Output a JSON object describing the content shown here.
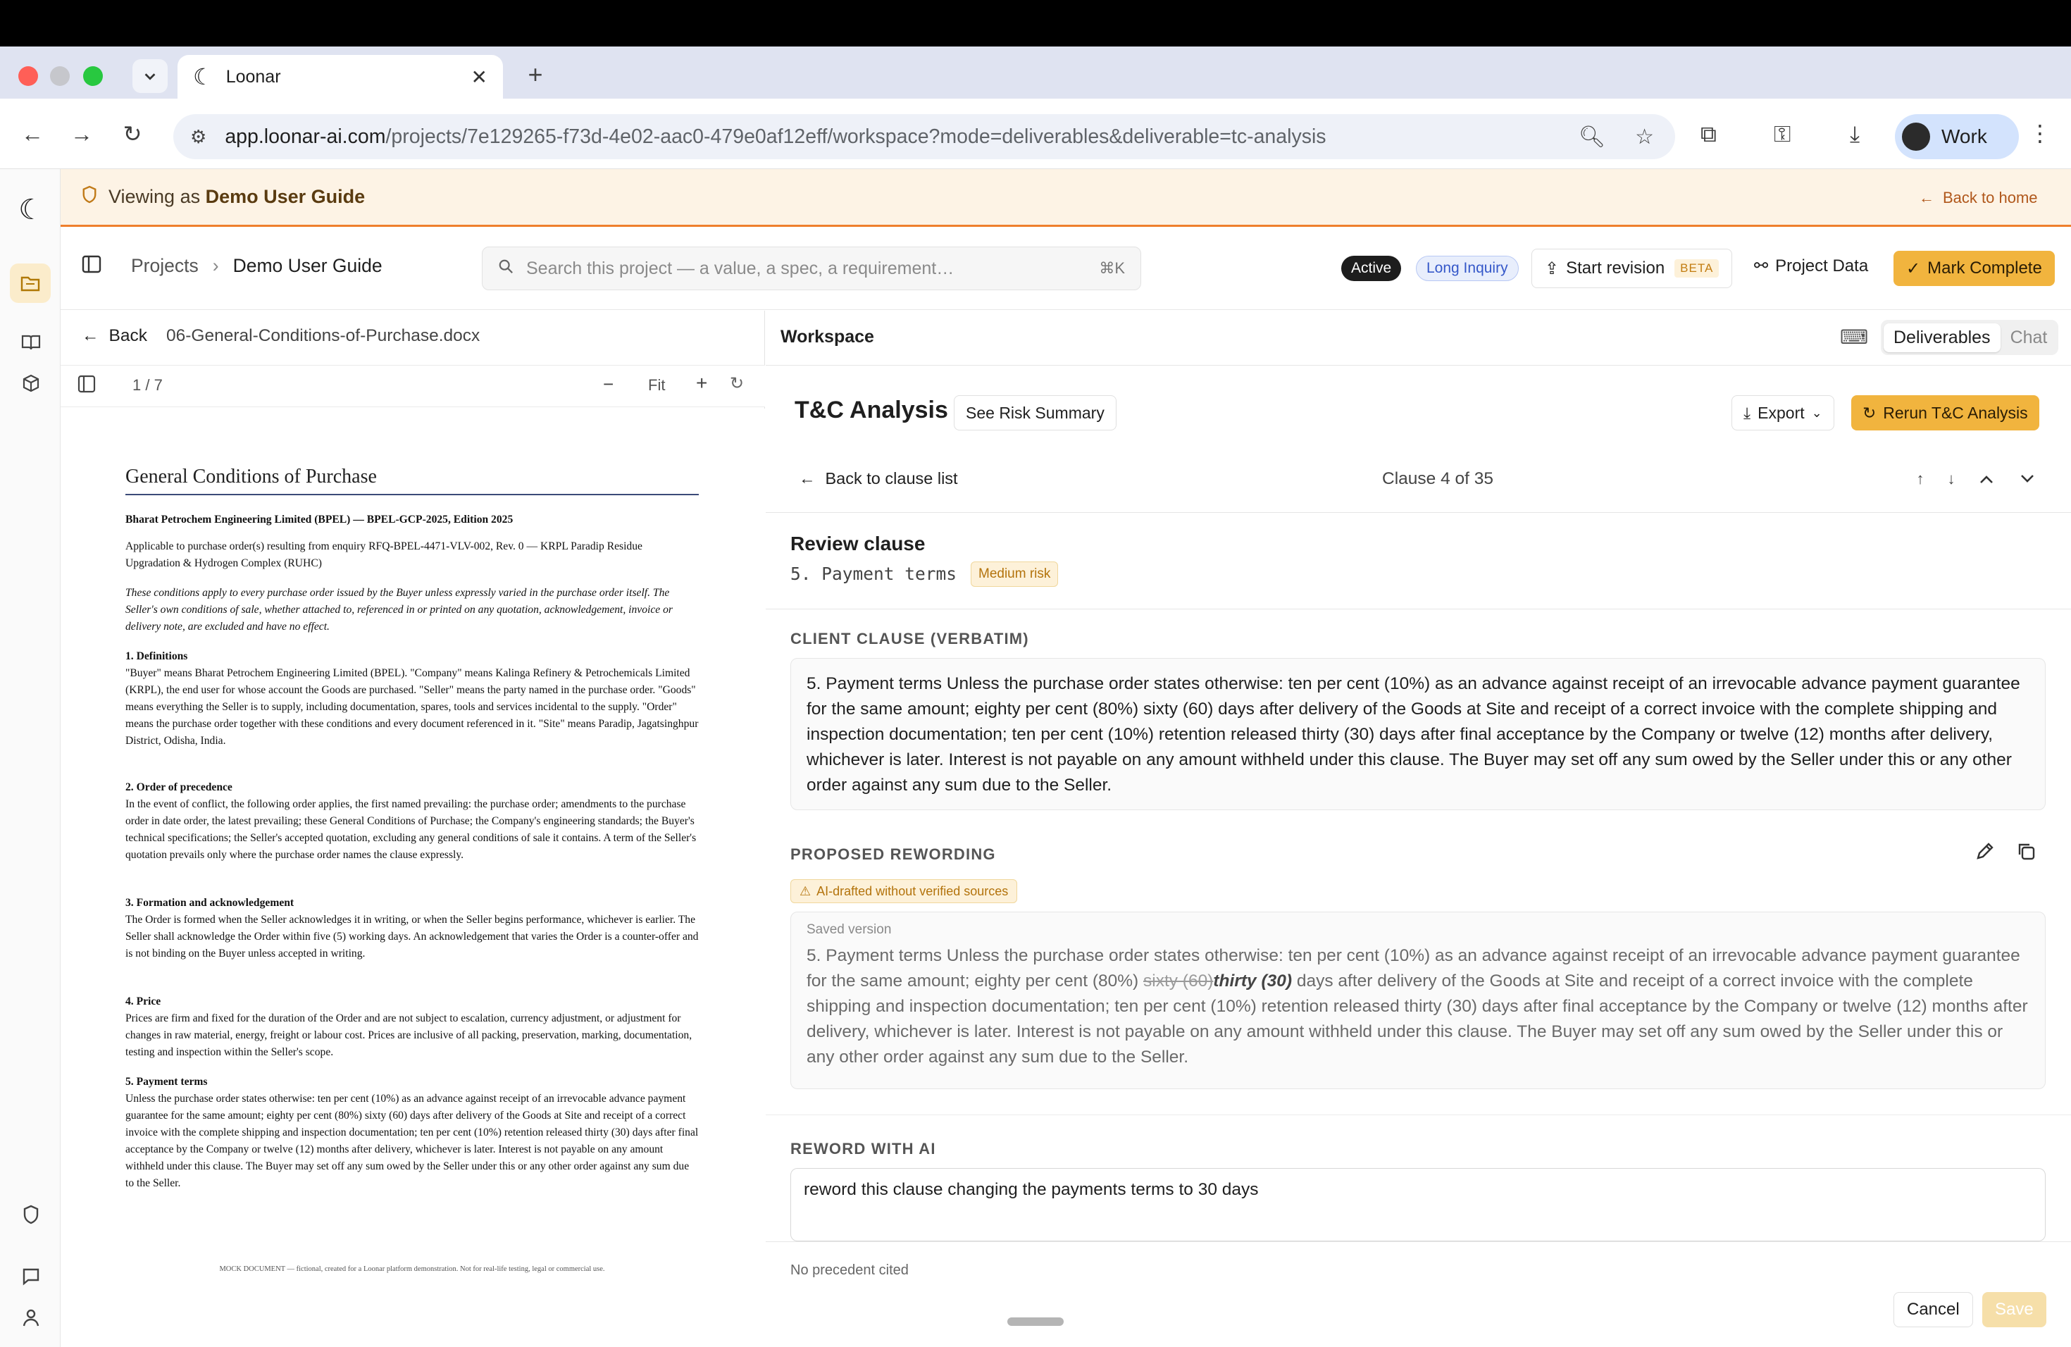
{
  "browser": {
    "tab_title": "Loonar",
    "url_host": "app.loonar-ai.com",
    "url_path": "/projects/7e129265-f73d-4e02-aac0-479e0af12eff/workspace?mode=deliverables&deliverable=tc-analysis",
    "profile_name": "Work"
  },
  "banner": {
    "viewing_prefix": "Viewing as",
    "viewing_name": "Demo User Guide",
    "back_home": "Back to home"
  },
  "header": {
    "crumb_projects": "Projects",
    "crumb_project": "Demo User Guide",
    "search_placeholder": "Search this project — a value, a spec, a requirement…",
    "search_shortcut": "⌘K",
    "status_badge": "Active",
    "type_badge": "Long Inquiry",
    "start_revision": "Start revision",
    "beta": "BETA",
    "project_data": "Project Data",
    "mark_complete": "Mark Complete"
  },
  "doc_panel": {
    "back": "Back",
    "filename": "06-General-Conditions-of-Purchase.docx",
    "page_indicator": "1 / 7",
    "fit": "Fit",
    "title": "General Conditions of Purchase",
    "heading_line": "Bharat Petrochem Engineering Limited (BPEL) — BPEL-GCP-2025, Edition 2025",
    "applicable": "Applicable to purchase order(s) resulting from enquiry RFQ-BPEL-4471-VLV-002, Rev. 0 — KRPL Paradip Residue Upgradation & Hydrogen Complex (RUHC)",
    "intro": "These conditions apply to every purchase order issued by the Buyer unless expressly varied in the purchase order itself. The Seller's own conditions of sale, whether attached to, referenced in or printed on any quotation, acknowledgement, invoice or delivery note, are excluded and have no effect.",
    "sections": [
      {
        "heading": "1. Definitions",
        "body": "\"Buyer\" means Bharat Petrochem Engineering Limited (BPEL). \"Company\" means Kalinga Refinery & Petrochemicals Limited (KRPL), the end user for whose account the Goods are purchased. \"Seller\" means the party named in the purchase order. \"Goods\" means everything the Seller is to supply, including documentation, spares, tools and services incidental to the supply. \"Order\" means the purchase order together with these conditions and every document referenced in it. \"Site\" means Paradip, Jagatsinghpur District, Odisha, India."
      },
      {
        "heading": "2. Order of precedence",
        "body": "In the event of conflict, the following order applies, the first named prevailing: the purchase order; amendments to the purchase order in date order, the latest prevailing; these General Conditions of Purchase; the Company's engineering standards; the Buyer's technical specifications; the Seller's accepted quotation, excluding any general conditions of sale it contains. A term of the Seller's quotation prevails only where the purchase order names the clause expressly."
      },
      {
        "heading": "3. Formation and acknowledgement",
        "body": "The Order is formed when the Seller acknowledges it in writing, or when the Seller begins performance, whichever is earlier. The Seller shall acknowledge the Order within five (5) working days. An acknowledgement that varies the Order is a counter-offer and is not binding on the Buyer unless accepted in writing."
      },
      {
        "heading": "4. Price",
        "body": "Prices are firm and fixed for the duration of the Order and are not subject to escalation, currency adjustment, or adjustment for changes in raw material, energy, freight or labour cost. Prices are inclusive of all packing, preservation, marking, documentation, testing and inspection within the Seller's scope."
      },
      {
        "heading": "5. Payment terms",
        "body": "Unless the purchase order states otherwise: ten per cent (10%) as an advance against receipt of an irrevocable advance payment guarantee for the same amount; eighty per cent (80%) sixty (60) days after delivery of the Goods at Site and receipt of a correct invoice with the complete shipping and inspection documentation; ten per cent (10%) retention released thirty (30) days after final acceptance by the Company or twelve (12) months after delivery, whichever is later. Interest is not payable on any amount withheld under this clause. The Buyer may set off any sum owed by the Seller under this or any other order against any sum due to the Seller."
      }
    ],
    "footer": "MOCK DOCUMENT — fictional, created for a Loonar platform demonstration. Not for real-life testing, legal or commercial use."
  },
  "workspace": {
    "title": "Workspace",
    "mode_active": "Deliverables",
    "mode_other": "Chat",
    "tc_title": "T&C Analysis",
    "risk_summary": "See Risk Summary",
    "export": "Export",
    "rerun": "Rerun T&C Analysis",
    "back_clauses": "Back to clause list",
    "clause_counter": "Clause 4 of 35",
    "review_heading": "Review clause",
    "clause_name": "5. Payment terms",
    "risk_level": "Medium risk",
    "client_label": "CLIENT CLAUSE (VERBATIM)",
    "client_text": "5. Payment terms Unless the purchase order states otherwise: ten per cent (10%) as an advance against receipt of an irrevocable advance payment guarantee for the same amount; eighty per cent (80%) sixty (60) days after delivery of the Goods at Site and receipt of a correct invoice with the complete shipping and inspection documentation; ten per cent (10%) retention released thirty (30) days after final acceptance by the Company or twelve (12) months after delivery, whichever is later. Interest is not payable on any amount withheld under this clause. The Buyer may set off any sum owed by the Seller under this or any other order against any sum due to the Seller.",
    "proposed_label": "PROPOSED REWORDING",
    "ai_badge": "AI-drafted without verified sources",
    "saved_label": "Saved version",
    "proposed_before": "5. Payment terms Unless the purchase order states otherwise: ten per cent (10%) as an advance against receipt of an irrevocable advance payment guarantee for the same amount; eighty per cent (80%) ",
    "proposed_deleted": "sixty (60)",
    "proposed_inserted": "thirty (30)",
    "proposed_after": " days after delivery of the Goods at Site and receipt of a correct invoice with the complete shipping and inspection documentation; ten per cent (10%) retention released thirty (30) days after final acceptance by the Company or twelve (12) months after delivery, whichever is later. Interest is not payable on any amount withheld under this clause. The Buyer may set off any sum owed by the Seller under this or any other order against any sum due to the Seller.",
    "reword_label": "REWORD WITH AI",
    "reword_value": "reword this clause changing the payments terms to 30 days",
    "no_precedent": "No precedent cited",
    "cancel": "Cancel",
    "save": "Save"
  },
  "colors": {
    "accent": "#f1b43e",
    "banner_bg": "#fdf3e5",
    "banner_rule": "#ef7f2c",
    "risk_medium": "#b3730c",
    "link_blue": "#3558c9"
  }
}
